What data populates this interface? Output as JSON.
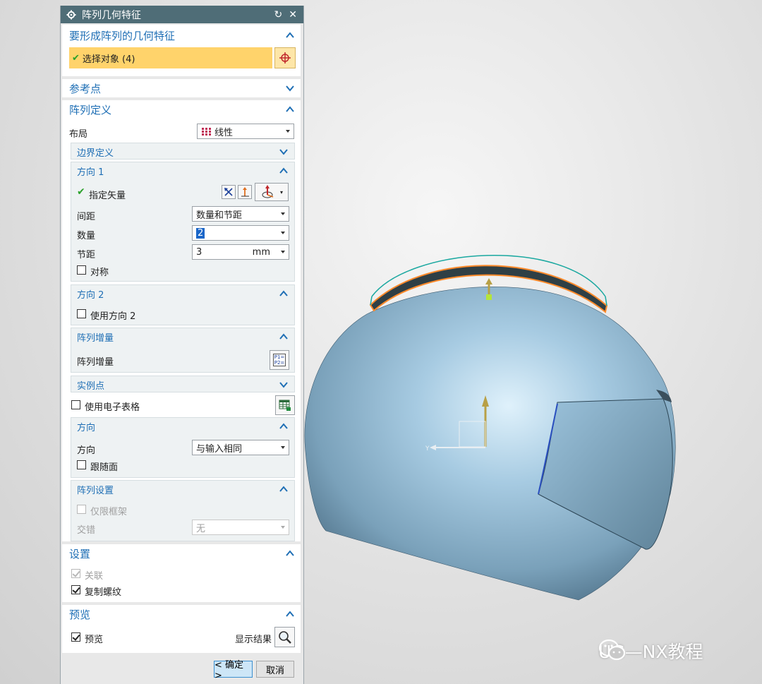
{
  "dialog": {
    "title": "阵列几何特征",
    "reset_glyph": "↻",
    "close_glyph": "✕",
    "geometry_section": {
      "title": "要形成阵列的几何特征",
      "select_label": "选择对象 (4)"
    },
    "ref_point_section": {
      "title": "参考点"
    },
    "pattern_def_section": {
      "title": "阵列定义",
      "layout_label": "布局",
      "layout_value": "线性",
      "boundary": {
        "title": "边界定义"
      },
      "direction1": {
        "title": "方向 1",
        "vector_label": "指定矢量",
        "spacing_label": "间距",
        "spacing_value": "数量和节距",
        "count_label": "数量",
        "count_value": "2",
        "pitch_label": "节距",
        "pitch_value": "3",
        "pitch_unit": "mm",
        "symmetric_label": "对称",
        "symmetric_checked": false
      },
      "direction2": {
        "title": "方向 2",
        "use_label": "使用方向 2",
        "use_checked": false
      },
      "increment": {
        "title": "阵列增量",
        "label": "阵列增量",
        "icon_text": "P1= P2="
      },
      "instance": {
        "title": "实例点",
        "spreadsheet_label": "使用电子表格",
        "spreadsheet_checked": false
      },
      "orientation": {
        "title": "方向",
        "label": "方向",
        "value": "与输入相同",
        "follow_face_label": "跟随面",
        "follow_face_checked": false
      },
      "pattern_settings": {
        "title": "阵列设置",
        "frame_only_label": "仅限框架",
        "stagger_label": "交错",
        "stagger_value": "无"
      }
    },
    "settings_section": {
      "title": "设置",
      "associative_label": "关联",
      "associative_checked": true,
      "copy_threads_label": "复制螺纹",
      "copy_threads_checked": true
    },
    "preview_section": {
      "title": "预览",
      "preview_label": "预览",
      "preview_checked": true,
      "show_result_label": "显示结果"
    },
    "ok_label": "< 确定 >",
    "cancel_label": "取消"
  },
  "viewport": {
    "axis_label": "Y",
    "watermark": "UG—NX教程"
  },
  "colors": {
    "title_bar": "#4f6d77",
    "section_header_text": "#1f6fb5",
    "selection_highlight": "#ffd36b",
    "model_surface": "#8fb3cc",
    "check_green": "#2aa12a"
  }
}
